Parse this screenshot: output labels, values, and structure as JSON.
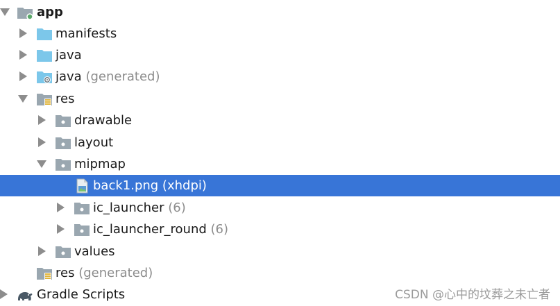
{
  "tree": {
    "app": {
      "label": "app"
    },
    "manifests": {
      "label": "manifests"
    },
    "java": {
      "label": "java"
    },
    "java_generated": {
      "label": "java",
      "suffix": "(generated)"
    },
    "res": {
      "label": "res"
    },
    "drawable": {
      "label": "drawable"
    },
    "layout": {
      "label": "layout"
    },
    "mipmap": {
      "label": "mipmap"
    },
    "back1": {
      "label": "back1.png (xhdpi)"
    },
    "ic_launcher": {
      "label": "ic_launcher",
      "suffix": "(6)"
    },
    "ic_launcher_round": {
      "label": "ic_launcher_round",
      "suffix": "(6)"
    },
    "values": {
      "label": "values"
    },
    "res_generated": {
      "label": "res",
      "suffix": "(generated)"
    },
    "gradle_scripts": {
      "label": "Gradle Scripts"
    }
  },
  "watermark": "CSDN @心中的坟葬之未亡者",
  "colors": {
    "selection": "#3875d7",
    "folder_blue": "#7cc7ea",
    "folder_gray": "#9aa7b0",
    "arrow": "#8d8d8d"
  }
}
